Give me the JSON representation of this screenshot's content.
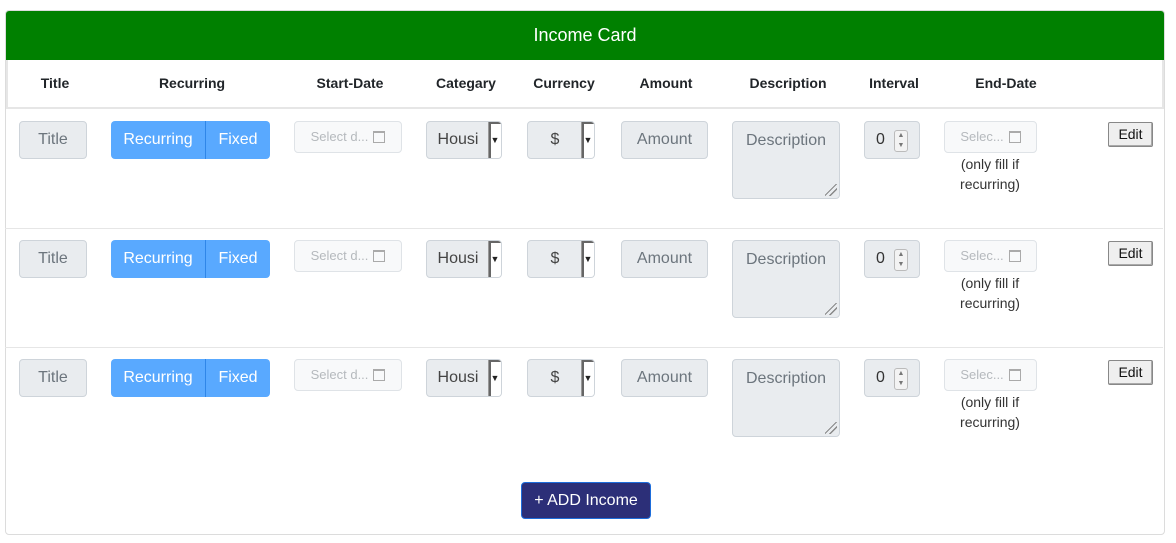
{
  "card": {
    "title": "Income Card"
  },
  "columns": [
    "Title",
    "Recurring",
    "Start-Date",
    "Categary",
    "Currency",
    "Amount",
    "Description",
    "Interval",
    "End-Date"
  ],
  "rows": [
    {
      "title_placeholder": "Title",
      "toggle_left": "Recurring",
      "toggle_right": "Fixed",
      "start_date_placeholder": "Select d...",
      "category": "Housi",
      "currency": "$",
      "amount_placeholder": "Amount",
      "description_placeholder": "Description",
      "interval": "0",
      "end_date_placeholder": "Selec...",
      "end_date_hint_1": "(only fill if",
      "end_date_hint_2": "recurring)",
      "edit_label": "Edit"
    },
    {
      "title_placeholder": "Title",
      "toggle_left": "Recurring",
      "toggle_right": "Fixed",
      "start_date_placeholder": "Select d...",
      "category": "Housi",
      "currency": "$",
      "amount_placeholder": "Amount",
      "description_placeholder": "Description",
      "interval": "0",
      "end_date_placeholder": "Selec...",
      "end_date_hint_1": "(only fill if",
      "end_date_hint_2": "recurring)",
      "edit_label": "Edit"
    },
    {
      "title_placeholder": "Title",
      "toggle_left": "Recurring",
      "toggle_right": "Fixed",
      "start_date_placeholder": "Select d...",
      "category": "Housi",
      "currency": "$",
      "amount_placeholder": "Amount",
      "description_placeholder": "Description",
      "interval": "0",
      "end_date_placeholder": "Selec...",
      "end_date_hint_1": "(only fill if",
      "end_date_hint_2": "recurring)",
      "edit_label": "Edit"
    }
  ],
  "add_button": "+ ADD Income",
  "icons": {
    "date": "calendar-icon",
    "dropdown": "chevron-down-icon",
    "spinner": "spinner-icon",
    "resize": "resize-grip-icon"
  },
  "colors": {
    "header_bg": "#008000",
    "toggle_bg": "#59a9ff",
    "add_button_bg": "#2c2f78"
  }
}
